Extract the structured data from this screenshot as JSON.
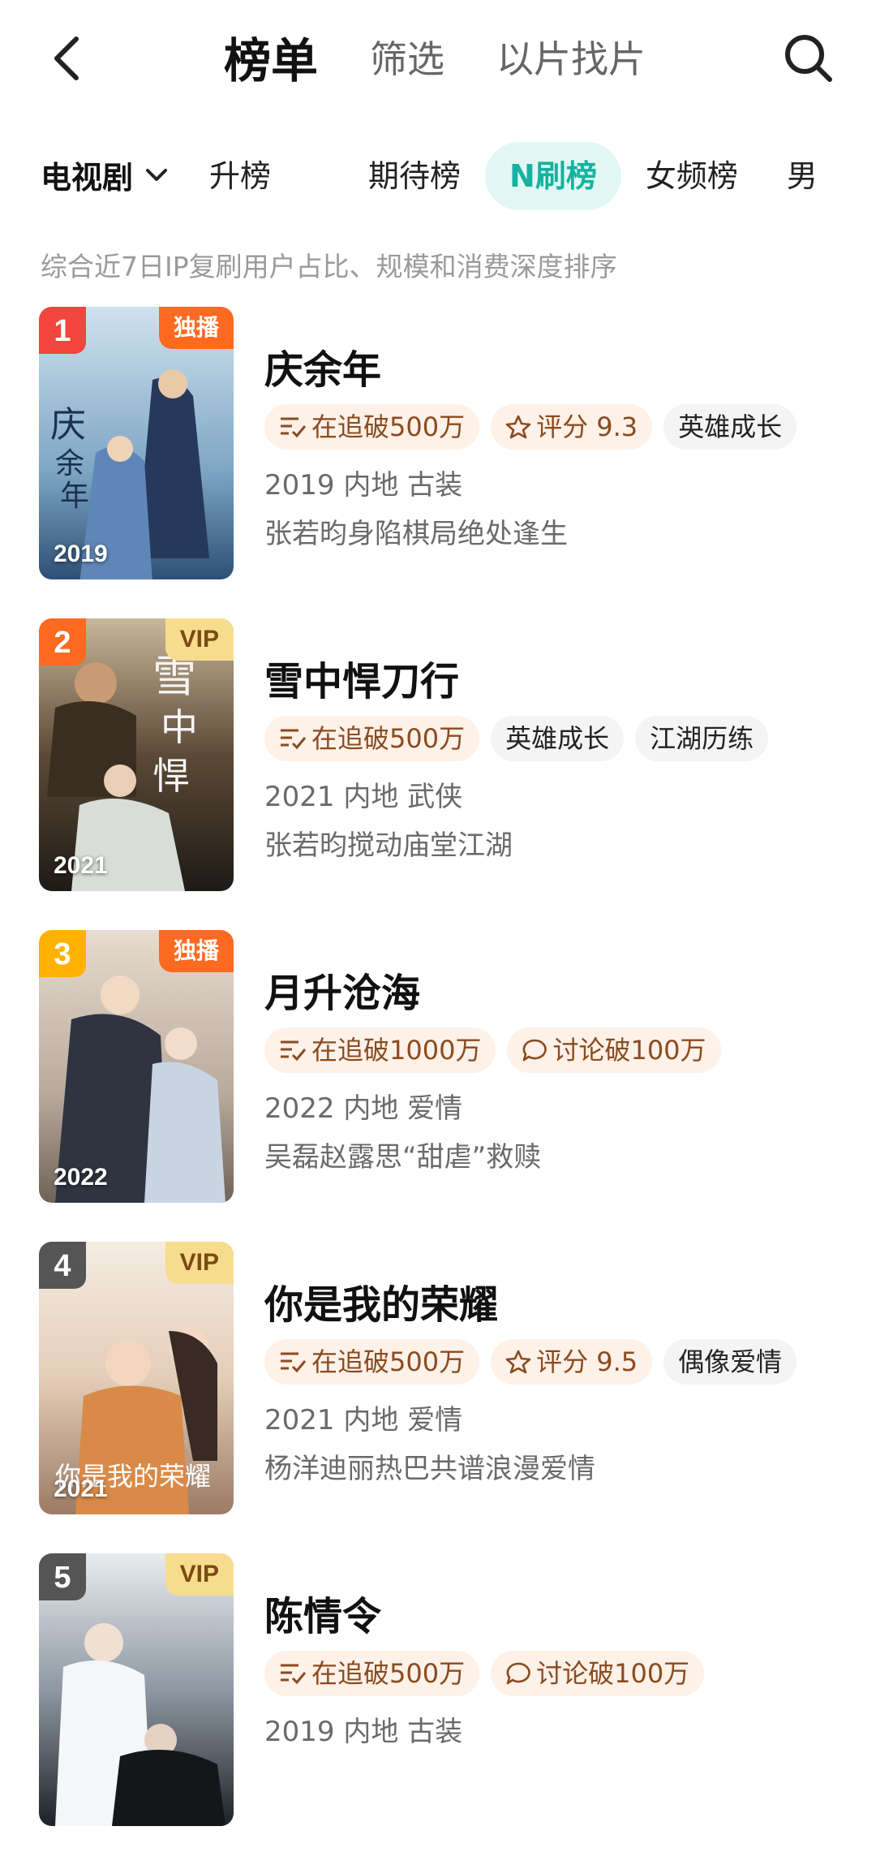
{
  "nav": {
    "tabs": [
      "榜单",
      "筛选",
      "以片找片"
    ],
    "active_tab": 0
  },
  "category": {
    "selected": "电视剧"
  },
  "subtabs": [
    "升榜",
    "期待榜",
    "N刷榜",
    "女频榜",
    "男"
  ],
  "active_subtab": 2,
  "description": "综合近7日IP复刷用户占比、规模和消费深度排序",
  "colors": {
    "accent": "#13b3a0",
    "rank1": "#f2453d",
    "rank2": "#ff6a21",
    "rank3": "#ffb100",
    "rank_other": "#555555"
  },
  "items": [
    {
      "rank": "1",
      "badge": "独播",
      "badge_type": "excl",
      "year": "2019",
      "title": "庆余年",
      "tags": [
        {
          "icon": "list-check-icon",
          "text": "在追破500万",
          "style": "hot"
        },
        {
          "icon": "star-icon",
          "text": "评分 9.3",
          "style": "hot"
        },
        {
          "icon": "",
          "text": "英雄成长",
          "style": "plain"
        }
      ],
      "meta": "2019 内地 古装",
      "summary": "张若昀身陷棋局绝处逢生"
    },
    {
      "rank": "2",
      "badge": "VIP",
      "badge_type": "vip",
      "year": "2021",
      "title": "雪中悍刀行",
      "tags": [
        {
          "icon": "list-check-icon",
          "text": "在追破500万",
          "style": "hot"
        },
        {
          "icon": "",
          "text": "英雄成长",
          "style": "plain"
        },
        {
          "icon": "",
          "text": "江湖历练",
          "style": "plain"
        }
      ],
      "meta": "2021 内地 武侠",
      "summary": "张若昀搅动庙堂江湖"
    },
    {
      "rank": "3",
      "badge": "独播",
      "badge_type": "excl",
      "year": "2022",
      "title": "月升沧海",
      "tags": [
        {
          "icon": "list-check-icon",
          "text": "在追破1000万",
          "style": "hot"
        },
        {
          "icon": "chat-bubble-icon",
          "text": "讨论破100万",
          "style": "hot"
        }
      ],
      "meta": "2022 内地 爱情",
      "summary": "吴磊赵露思“甜虐”救赎"
    },
    {
      "rank": "4",
      "badge": "VIP",
      "badge_type": "vip",
      "year": "2021",
      "title": "你是我的荣耀",
      "tags": [
        {
          "icon": "list-check-icon",
          "text": "在追破500万",
          "style": "hot"
        },
        {
          "icon": "star-icon",
          "text": "评分 9.5",
          "style": "hot"
        },
        {
          "icon": "",
          "text": "偶像爱情",
          "style": "plain"
        }
      ],
      "meta": "2021 内地 爱情",
      "summary": "杨洋迪丽热巴共谱浪漫爱情"
    },
    {
      "rank": "5",
      "badge": "VIP",
      "badge_type": "vip",
      "year": "",
      "title": "陈情令",
      "tags": [
        {
          "icon": "list-check-icon",
          "text": "在追破500万",
          "style": "hot"
        },
        {
          "icon": "chat-bubble-icon",
          "text": "讨论破100万",
          "style": "hot"
        }
      ],
      "meta": "2019 内地 古装",
      "summary": ""
    }
  ]
}
